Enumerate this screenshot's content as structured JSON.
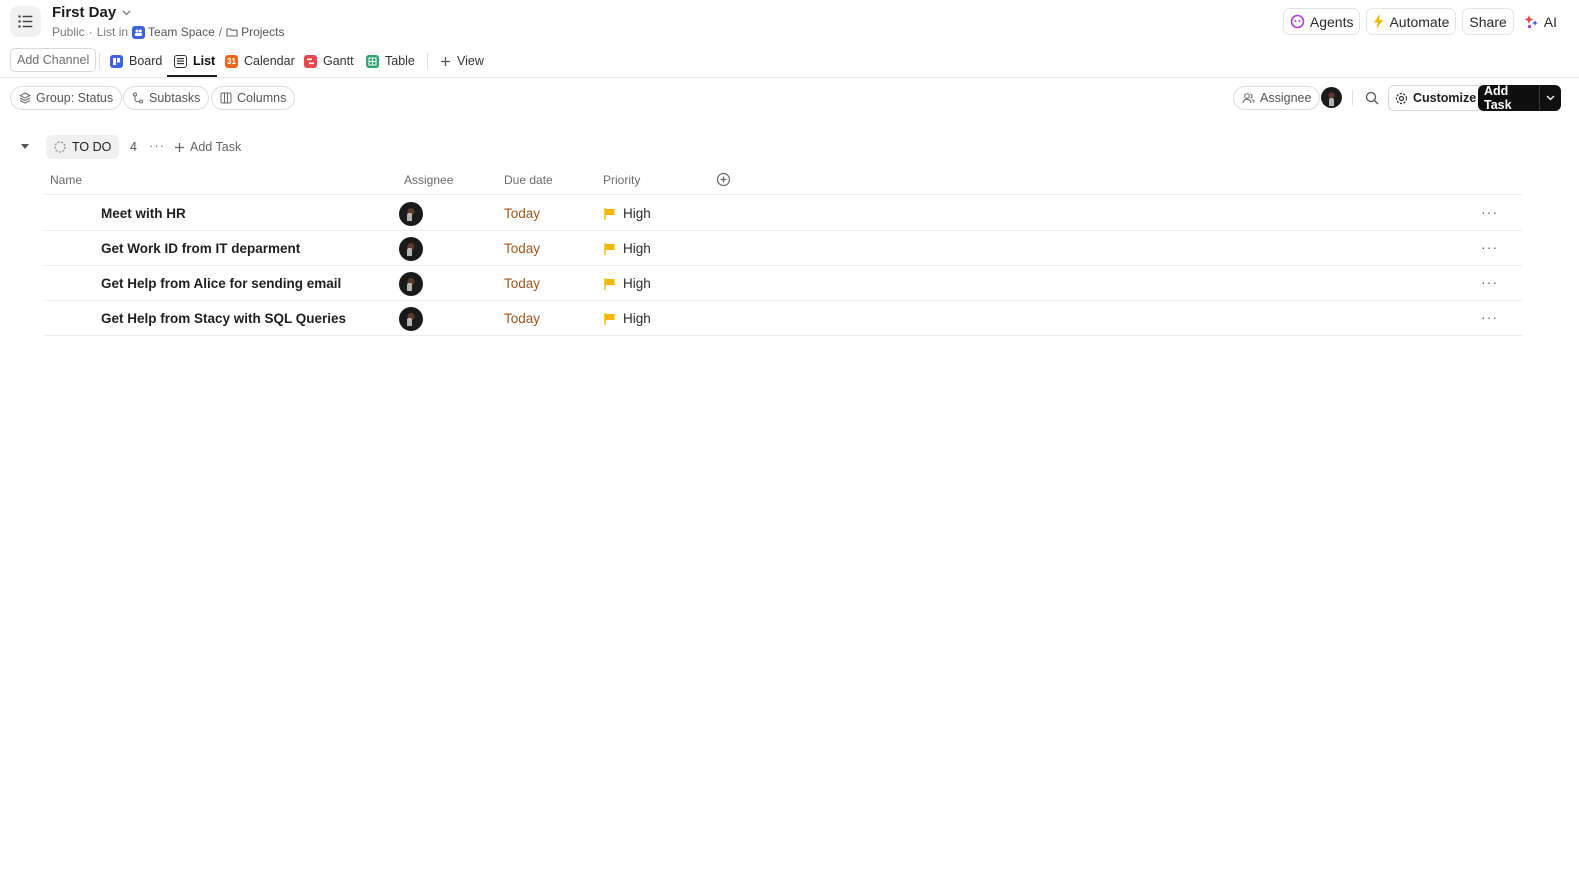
{
  "header": {
    "title": "First Day",
    "visibility": "Public",
    "list_in": "List in",
    "workspace": "Team Space",
    "separator": "/",
    "folder": "Projects",
    "actions": {
      "agents": "Agents",
      "automate": "Automate",
      "share": "Share",
      "ai": "AI"
    }
  },
  "views": {
    "add_channel": "Add Channel",
    "tabs": [
      {
        "label": "Board",
        "icon": "board-icon",
        "color": "#3d63dd"
      },
      {
        "label": "List",
        "icon": "list-icon",
        "color": "#333333",
        "active": true
      },
      {
        "label": "Calendar",
        "icon": "calendar-icon",
        "color": "#f0671f",
        "glyph": "31"
      },
      {
        "label": "Gantt",
        "icon": "gantt-icon",
        "color": "#e5484d"
      },
      {
        "label": "Table",
        "icon": "table-icon",
        "color": "#30a46c"
      }
    ],
    "add_view": "View"
  },
  "toolbar": {
    "group": "Group: Status",
    "subtasks": "Subtasks",
    "columns": "Columns",
    "assignee": "Assignee",
    "customize": "Customize",
    "add_task": "Add Task"
  },
  "group": {
    "status": "TO DO",
    "count": "4",
    "add_task": "Add Task"
  },
  "table": {
    "columns": [
      "Name",
      "Assignee",
      "Due date",
      "Priority"
    ],
    "rows": [
      {
        "name": "Meet with HR",
        "due": "Today",
        "priority": "High"
      },
      {
        "name": "Get Work ID from IT deparment",
        "due": "Today",
        "priority": "High"
      },
      {
        "name": "Get Help from Alice for sending email",
        "due": "Today",
        "priority": "High"
      },
      {
        "name": "Get Help from Stacy with SQL Queries",
        "due": "Today",
        "priority": "High"
      }
    ]
  },
  "colors": {
    "due_today": "#a0561d",
    "priority_high": "#f5b800",
    "primary_button": "#0f0f0f"
  }
}
